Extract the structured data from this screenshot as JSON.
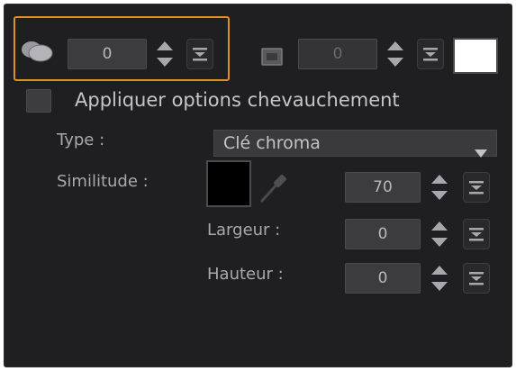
{
  "top_row": {
    "opacity_value": "0",
    "second_value": "0"
  },
  "overlap": {
    "checkbox_label": "Appliquer options chevauchement"
  },
  "type_row": {
    "label": "Type :",
    "selected": "Clé chroma"
  },
  "similarity_row": {
    "label": "Similitude :",
    "value": "70"
  },
  "width_row": {
    "label": "Largeur :",
    "value": "0"
  },
  "height_row": {
    "label": "Hauteur :",
    "value": "0"
  },
  "colors": {
    "panel_bg": "#1f1f21",
    "highlight": "#e0901e",
    "key_color_swatch": "#000000",
    "fill_color_swatch": "#ffffff"
  },
  "icons": {
    "layers": "layers-icon",
    "screen": "screen-icon",
    "eyedropper": "eyedropper-icon",
    "spinner": "spinner-arrows-icon",
    "dropdown": "dropdown-menu-icon"
  }
}
